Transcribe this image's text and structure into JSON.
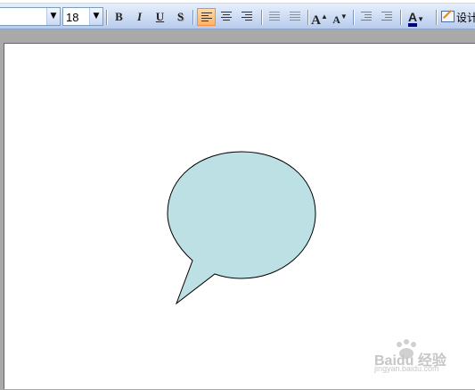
{
  "toolbar": {
    "font_size_value": "18",
    "bold_label": "B",
    "italic_label": "I",
    "underline_label": "U",
    "shadow_label": "S",
    "grow_font_label": "A",
    "shrink_font_label": "A",
    "font_color_label": "A",
    "design_label": "设计",
    "font_color": "#000080",
    "active_button": "align-left"
  },
  "slide": {
    "callout_fill": "#bde0e4",
    "callout_stroke": "#000000"
  },
  "watermark": {
    "brand_text": "Baidu 经验",
    "sub_text": "jingyan.baidu.com"
  }
}
